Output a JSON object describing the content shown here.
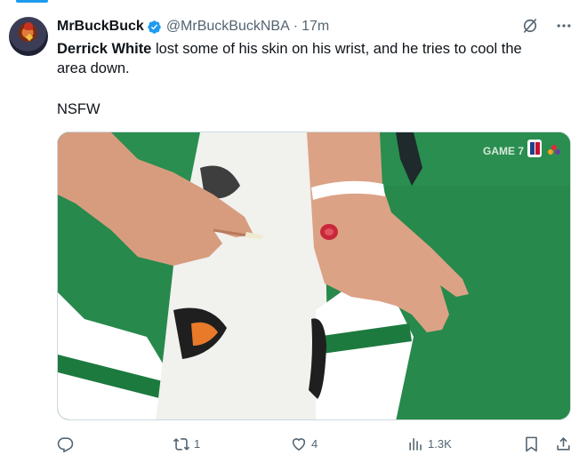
{
  "tweet": {
    "author_name": "MrBuckBuck",
    "handle": "@MrBuckBuckNBA",
    "separator": "·",
    "time": "17m",
    "text_bold": "Derrick White",
    "text_rest_line1": " lost some of his skin on his wrist, and he tries to cool the",
    "text_line2": "area down.",
    "text_line3": "NSFW"
  },
  "media": {
    "overlay_text": "GAME 7"
  },
  "actions": {
    "reply_count": "",
    "retweet_count": "1",
    "like_count": "4",
    "views_count": "1.3K"
  },
  "colors": {
    "accent": "#1d9bf0",
    "secondary_text": "#536471",
    "court_green": "#25874a"
  },
  "icons": [
    "verified-icon",
    "grok-icon",
    "more-icon",
    "reply-icon",
    "retweet-icon",
    "like-icon",
    "views-icon",
    "bookmark-icon",
    "share-icon"
  ]
}
